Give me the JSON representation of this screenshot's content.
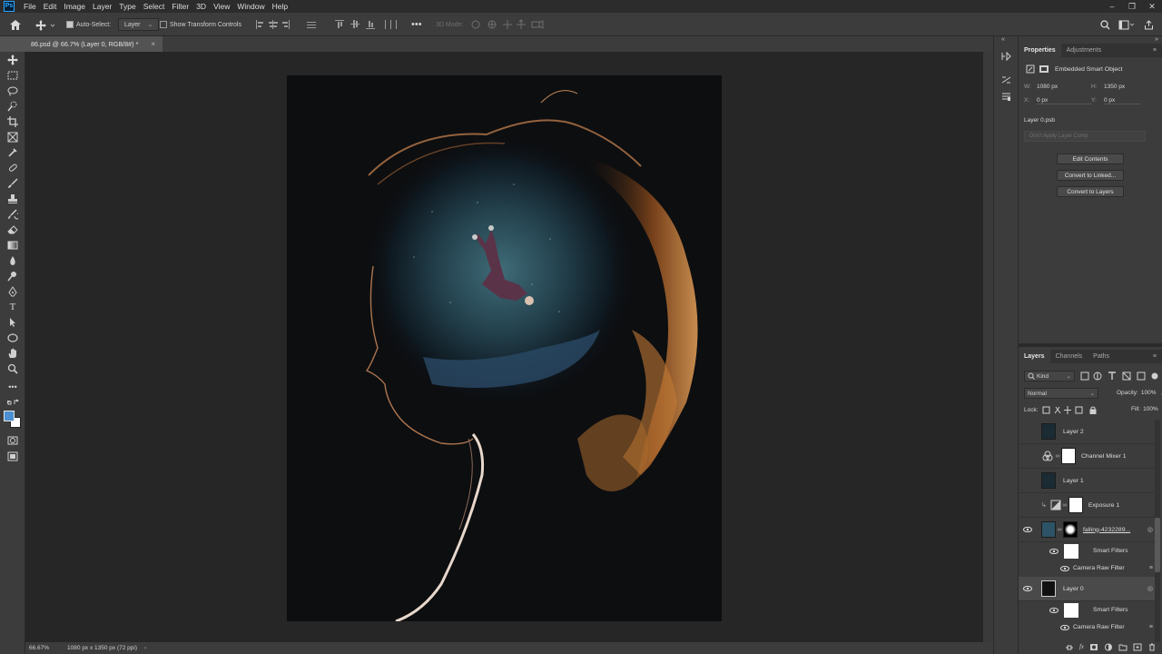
{
  "app": {
    "logo": "Ps"
  },
  "menu": [
    "File",
    "Edit",
    "Image",
    "Layer",
    "Type",
    "Select",
    "Filter",
    "3D",
    "View",
    "Window",
    "Help"
  ],
  "options": {
    "auto_select_label": "Auto-Select:",
    "auto_select_target": "Layer",
    "transform_label": "Show Transform Controls",
    "threed_mode": "3D Mode:"
  },
  "document": {
    "tab_title": "86.psd @ 66.7% (Layer 0, RGB/8#) *"
  },
  "status": {
    "zoom": "66.67%",
    "doc_info": "1080 px x 1350 px (72 ppi)"
  },
  "properties": {
    "tabs": [
      "Properties",
      "Adjustments"
    ],
    "object_type": "Embedded Smart Object",
    "w_label": "W:",
    "w_value": "1080 px",
    "h_label": "H:",
    "h_value": "1350 px",
    "x_label": "X:",
    "x_value": "0 px",
    "y_label": "Y:",
    "y_value": "0 px",
    "source_file": "Layer 0.psb",
    "layer_comp": "Don't Apply Layer Comp",
    "buttons": [
      "Edit Contents",
      "Convert to Linked...",
      "Convert to Layers"
    ]
  },
  "layers_panel": {
    "tabs": [
      "Layers",
      "Channels",
      "Paths"
    ],
    "filter_kind": "Kind",
    "blend_mode": "Normal",
    "opacity_label": "Opacity:",
    "opacity_value": "100%",
    "lock_label": "Lock:",
    "fill_label": "Fill:",
    "fill_value": "100%",
    "layers": [
      {
        "name": "Layer 2"
      },
      {
        "name": "Channel Mixer 1"
      },
      {
        "name": "Layer 1"
      },
      {
        "name": "Exposure 1"
      },
      {
        "name": "falling-4232289..."
      },
      {
        "name": "Smart Filters"
      },
      {
        "name": "Camera Raw Filter"
      },
      {
        "name": "Layer 0"
      },
      {
        "name": "Smart Filters"
      },
      {
        "name": "Camera Raw Filter"
      }
    ]
  },
  "colors": {
    "foreground": "#4a8fd0",
    "background": "#ffffff",
    "accent": "#31a8ff"
  }
}
